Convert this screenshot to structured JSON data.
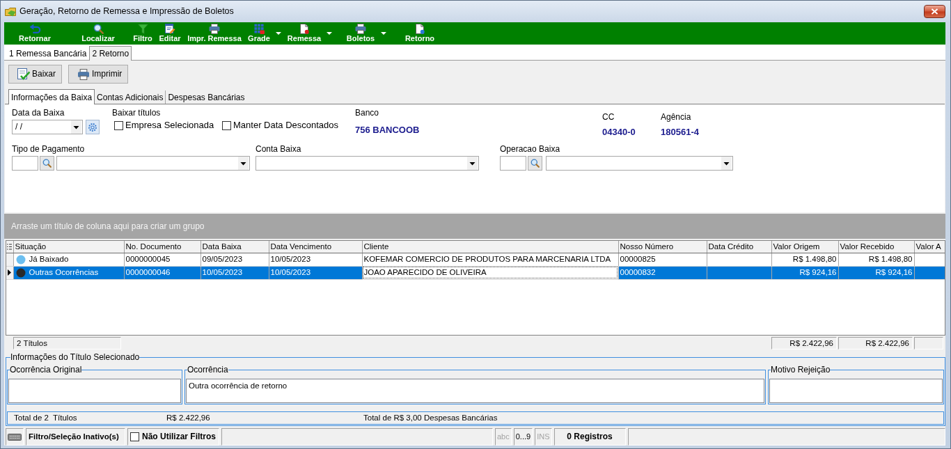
{
  "window": {
    "title": "Geração, Retorno de Remessa e Impressão de Boletos"
  },
  "toolbar": [
    {
      "label": "Retornar",
      "dropdown": false
    },
    {
      "label": "Localizar",
      "dropdown": false
    },
    {
      "label": "Filtro",
      "dropdown": false
    },
    {
      "label": "Editar",
      "dropdown": false
    },
    {
      "label": "Impr. Remessa",
      "dropdown": false
    },
    {
      "label": "Grade",
      "dropdown": true
    },
    {
      "label": "Remessa",
      "dropdown": true
    },
    {
      "label": "Boletos",
      "dropdown": true
    },
    {
      "label": "Retorno",
      "dropdown": false
    }
  ],
  "main_tabs": [
    {
      "label": "1 Remessa Bancária",
      "selected": false
    },
    {
      "label": "2 Retorno",
      "selected": true
    }
  ],
  "actions": [
    "Baixar",
    "Imprimir"
  ],
  "detail_tabs": [
    {
      "label": "Informações da Baixa",
      "selected": true
    },
    {
      "label": "Contas Adicionais",
      "selected": false
    },
    {
      "label": "Despesas Bancárias",
      "selected": false
    }
  ],
  "form": {
    "data_da_baixa": {
      "label": "Data da Baixa",
      "value": "/ /"
    },
    "baixar_titulos": {
      "label": "Baixar títulos",
      "options": [
        {
          "label": "Empresa Selecionada",
          "checked": false
        },
        {
          "label": "Manter Data Descontados",
          "checked": false
        }
      ]
    },
    "banco": {
      "label": "Banco",
      "value": "756 BANCOOB"
    },
    "cc": {
      "label": "CC",
      "value": "04340-0"
    },
    "agencia": {
      "label": "Agência",
      "value": "180561-4"
    },
    "tipo_de_pagamento": {
      "label": "Tipo de Pagamento"
    },
    "conta_baixa": {
      "label": "Conta Baixa"
    },
    "operacao_baixa": {
      "label": "Operacao Baixa"
    }
  },
  "group_panel": {
    "hint": "Arraste um título de coluna aqui para criar um grupo"
  },
  "grid": {
    "columns": [
      "Situação",
      "No. Documento",
      "Data Baixa",
      "Data Vencimento",
      "Cliente",
      "Nosso Número",
      "Data Crédito",
      "Valor Origem",
      "Valor Recebido",
      "Valor A"
    ],
    "rows": [
      {
        "selected": false,
        "color": "#6cbff0",
        "cells": [
          {
            "text": "Já Baixado",
            "focused": false
          },
          {
            "text": "0000000045",
            "focused": false
          },
          {
            "text": "09/05/2023",
            "focused": false
          },
          {
            "text": "10/05/2023",
            "focused": false
          },
          {
            "text": "KOFEMAR COMERCIO DE PRODUTOS PARA MARCENARIA LTDA",
            "focused": false
          },
          {
            "text": "00000825",
            "focused": false
          },
          {
            "focused": false
          },
          {
            "text": "R$ 1.498,80",
            "focused": false
          },
          {
            "text": "R$ 1.498,80",
            "focused": false
          },
          {
            "focused": false
          }
        ]
      },
      {
        "selected": true,
        "color": "#2a2a2a",
        "cells": [
          {
            "text": "Outras Ocorrências",
            "focused": false
          },
          {
            "text": "0000000046",
            "focused": false
          },
          {
            "text": "10/05/2023",
            "focused": false
          },
          {
            "text": "10/05/2023",
            "focused": false
          },
          {
            "text": "JOAO APARECIDO DE OLIVEIRA",
            "focused": true
          },
          {
            "text": "00000832",
            "focused": false
          },
          {
            "focused": false
          },
          {
            "text": "R$ 924,16",
            "focused": false
          },
          {
            "text": "R$ 924,16",
            "focused": false
          },
          {
            "focused": false
          }
        ]
      }
    ],
    "footer": {
      "count": "2 Títulos",
      "totals": [
        "R$ 2.422,96",
        "R$ 2.422,96"
      ]
    }
  },
  "selected_title": {
    "title": "Informações do Título Selecionado",
    "boxes": [
      {
        "label": "Ocorrência Original"
      },
      {
        "label": "Ocorrência",
        "text": "Outra ocorrência de retorno"
      },
      {
        "label": "Motivo Rejeição"
      }
    ],
    "totals": [
      "Total de 2  Títulos",
      "R$ 2.422,96",
      "Total de R$ 3,00 Despesas Bancárias"
    ]
  },
  "status_bar": {
    "filter_state": "Filtro/Seleção Inativo(s)",
    "no_filters": {
      "label": "Não Utilizar Filtros",
      "checked": false
    },
    "indicators": [
      {
        "label": "abc",
        "active": false
      },
      {
        "label": "0...9",
        "active": true
      },
      {
        "label": "INS",
        "active": false
      }
    ],
    "records": "0 Registros"
  }
}
